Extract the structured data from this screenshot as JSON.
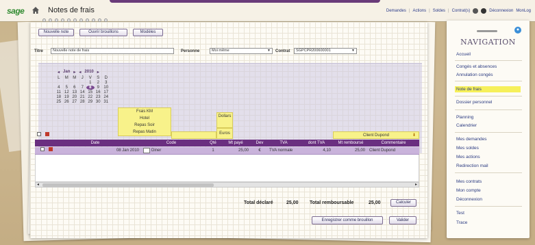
{
  "app": {
    "logo": "sage",
    "title": "Notes de frais"
  },
  "topnav": {
    "items": [
      "Demandes",
      "Actions",
      "Soldes",
      "Contrat(s)"
    ],
    "logout": "Déconnexion",
    "user": "MonLog"
  },
  "toolbar": {
    "new_note": "Nouvelle note",
    "open_draft": "Ouvrir brouillons",
    "models": "Modèles"
  },
  "form": {
    "title_label": "Titre",
    "title_value": "Nouvelle note de frais",
    "person_label": "Personne",
    "person_value": "Moi même",
    "contract_label": "Contrat",
    "contract_value": "SGPCPR200600001"
  },
  "calendar": {
    "month": "Jan",
    "year": "2010",
    "nav_prev": "◂",
    "nav_next": "▸",
    "day_headers": [
      "L",
      "M",
      "M",
      "J",
      "V",
      "S",
      "D"
    ],
    "weeks": [
      [
        "",
        "",
        "",
        "",
        "1",
        "2",
        "3"
      ],
      [
        "4",
        "5",
        "6",
        "7",
        "8",
        "9",
        "10"
      ],
      [
        "11",
        "12",
        "13",
        "14",
        "15",
        "16",
        "17"
      ],
      [
        "18",
        "19",
        "20",
        "21",
        "22",
        "23",
        "24"
      ],
      [
        "25",
        "26",
        "27",
        "28",
        "29",
        "30",
        "31"
      ]
    ],
    "selected": "8"
  },
  "code_dropdown": {
    "options": [
      "Frais KM",
      "Hotel",
      "Repas Soir",
      "Repas Matin"
    ]
  },
  "currency_dropdown": {
    "options": [
      "Dollars",
      "Euros"
    ]
  },
  "comment_dropdown": {
    "value": "Client Dupond"
  },
  "table": {
    "columns": [
      "Date",
      "Code",
      "Qté",
      "Mt payé",
      "Dev",
      "TVA",
      "dont TVA",
      "Mt remboursé",
      "Commentaire"
    ],
    "rows": [
      {
        "date": "08 Jan 2010",
        "code": "Diner",
        "qty": "1",
        "paid": "25,00",
        "dev": "€",
        "tva": "TVA normale",
        "vat_amount": "4,10",
        "refund": "25,00",
        "comment": "Client Dupond"
      }
    ]
  },
  "totals": {
    "declared_label": "Total déclaré",
    "declared_value": "25,00",
    "refund_label": "Total remboursable",
    "refund_value": "25,00",
    "calc_button": "Calculer"
  },
  "actions": {
    "save_draft": "Enregistrer comme brouillon",
    "validate": "Valider"
  },
  "navigation": {
    "title": "NAVIGATION",
    "groups": [
      [
        "Accueil"
      ],
      [
        "Congés et absences",
        "Annulation congés"
      ],
      [
        "Note de frais"
      ],
      [
        "Dossier personnel"
      ],
      [
        "Planning",
        "Calendrier"
      ],
      [
        "Mes demandes",
        "Mes soldes",
        "Mes actions",
        "Redirection mail"
      ],
      [
        "Mes contrats",
        "Mon compte",
        "Déconnexion"
      ],
      [
        "Test",
        "Trace"
      ]
    ],
    "active": "Note de frais"
  },
  "colors": {
    "accent_purple": "#6a2f80",
    "highlight_yellow": "#f6f05a",
    "row_lavender": "#c9b3db",
    "link_blue": "#2a3a80"
  }
}
